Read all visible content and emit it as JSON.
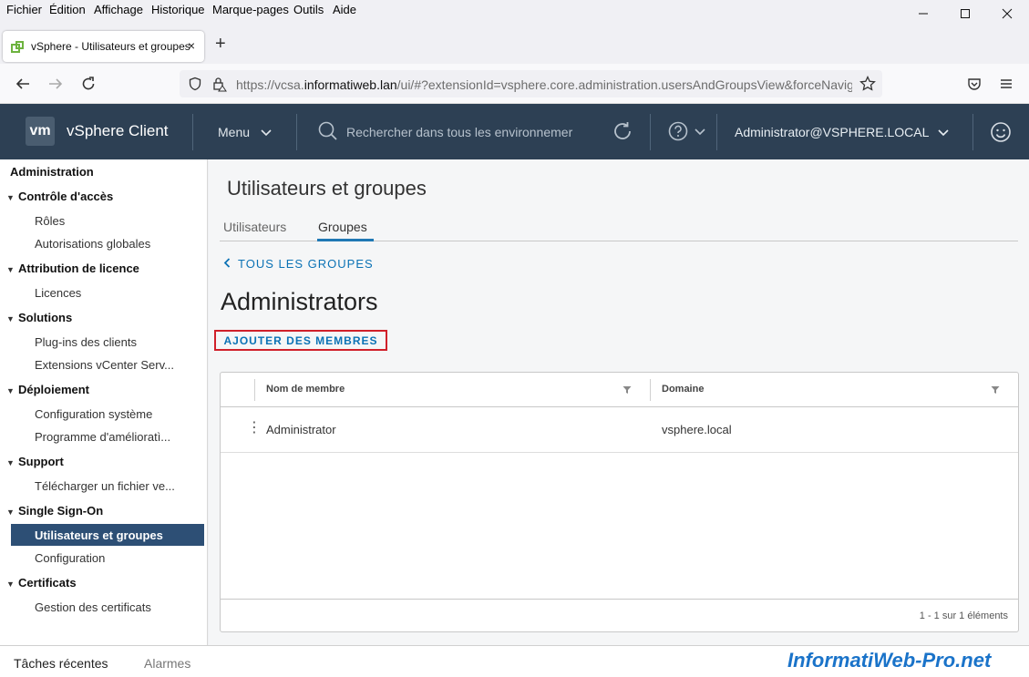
{
  "browser": {
    "menus": [
      "Fichier",
      "Édition",
      "Affichage",
      "Historique",
      "Marque-pages",
      "Outils",
      "Aide"
    ],
    "tab_title": "vSphere - Utilisateurs et groupes",
    "tab_close": "×",
    "new_tab": "+",
    "url_prefix": "https://vcsa.",
    "url_domain": "informatiweb.lan",
    "url_rest": "/ui/#?extensionId=vsphere.core.administration.usersAndGroupsView&forceNavigat",
    "window_controls": {
      "minimize": "—",
      "maximize": "☐",
      "close": "✕"
    }
  },
  "header": {
    "logo": "vm",
    "app_name": "vSphere Client",
    "menu_label": "Menu",
    "search_placeholder": "Rechercher dans tous les environnemer",
    "user": "Administrator@VSPHERE.LOCAL"
  },
  "sidebar": {
    "title": "Administration",
    "sections": [
      {
        "label": "Contrôle d'accès",
        "items": [
          "Rôles",
          "Autorisations globales"
        ]
      },
      {
        "label": "Attribution de licence",
        "items": [
          "Licences"
        ]
      },
      {
        "label": "Solutions",
        "items": [
          "Plug-ins des clients",
          "Extensions vCenter Serv..."
        ]
      },
      {
        "label": "Déploiement",
        "items": [
          "Configuration système",
          "Programme d'amélioratì..."
        ]
      },
      {
        "label": "Support",
        "items": [
          "Télécharger un fichier ve..."
        ]
      },
      {
        "label": "Single Sign-On",
        "items": [
          "Utilisateurs et groupes",
          "Configuration"
        ]
      },
      {
        "label": "Certificats",
        "items": [
          "Gestion des certificats"
        ]
      }
    ],
    "active_item": "Utilisateurs et groupes"
  },
  "main": {
    "page_title": "Utilisateurs et groupes",
    "tabs": [
      "Utilisateurs",
      "Groupes"
    ],
    "active_tab": "Groupes",
    "back_link": "TOUS LES GROUPES",
    "group_name": "Administrators",
    "add_members_button": "AJOUTER DES MEMBRES",
    "table": {
      "columns": [
        "Nom de membre",
        "Domaine"
      ],
      "rows": [
        {
          "name": "Administrator",
          "domain": "vsphere.local"
        }
      ],
      "footer": "1 - 1 sur 1 éléments"
    }
  },
  "bottom": {
    "recent_tasks": "Tâches récentes",
    "alarms": "Alarmes",
    "watermark": "InformatiWeb-Pro.net"
  },
  "colors": {
    "header_bg": "#2d4054",
    "link": "#0b72b5",
    "active_nav": "#2d4f75",
    "highlight_border": "#d0202a"
  }
}
